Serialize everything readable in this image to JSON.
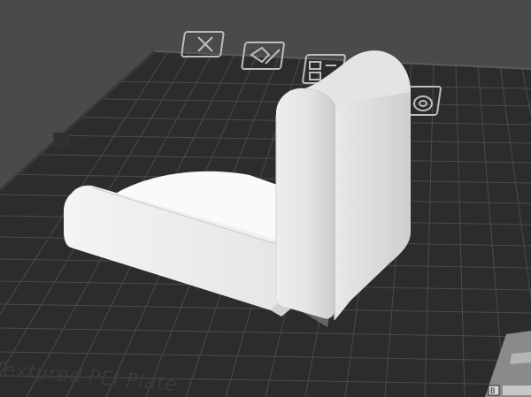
{
  "viewport": {
    "background": "#4a4a4c",
    "plate": {
      "label": "Textured PEI Plate",
      "surface_color": "#2c2c2e",
      "grid_color": "#4b4b4e",
      "edge_color": "#3a3a3c"
    },
    "plate_icons": [
      {
        "name": "close-icon"
      },
      {
        "name": "edit-plate-icon"
      },
      {
        "name": "arrange-icon"
      },
      {
        "name": "plate-settings-icon"
      }
    ],
    "model": {
      "name": "l-bracket",
      "face_color": "#f2f2f2",
      "side_color": "#d8d8d8",
      "shadow_color": "#b8b8b8"
    },
    "corner_badge": {
      "label": "B"
    }
  }
}
